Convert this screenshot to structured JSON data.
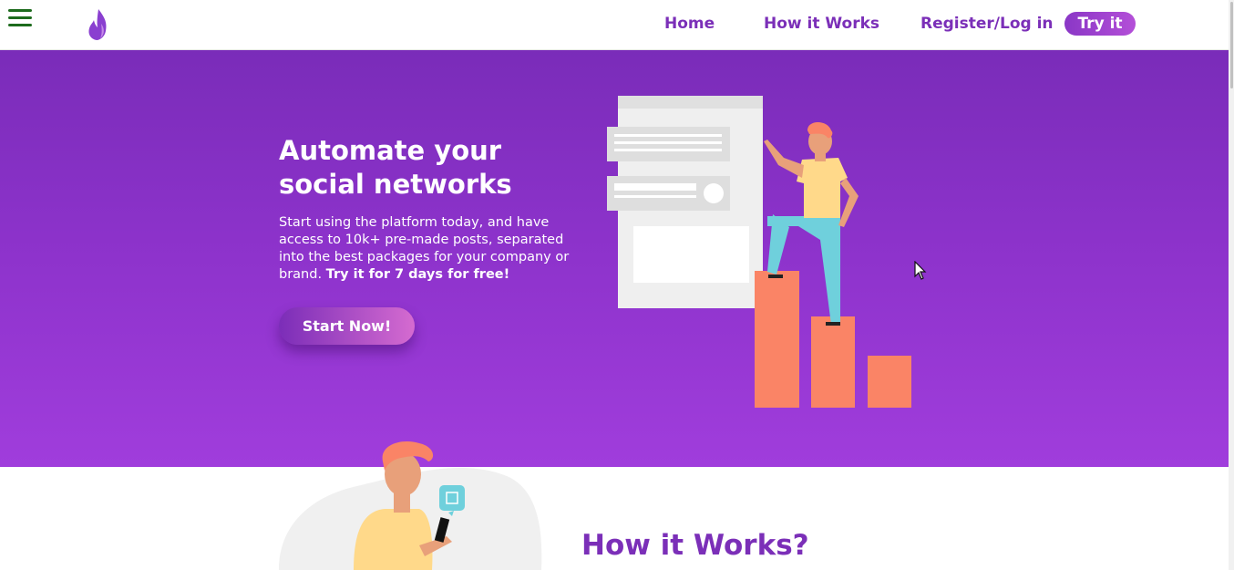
{
  "header": {
    "nav": {
      "home": "Home",
      "how_it_works": "How it Works",
      "register_login": "Register/Log in",
      "try_it": "Try it"
    }
  },
  "hero": {
    "title": "Automate your social networks",
    "description": "Start using the platform today, and have access to 10k+ pre-made posts, separated into the best packages for your company or brand.",
    "description_bold": "Try it for 7 days for free!",
    "cta_label": "Start Now!"
  },
  "how_section": {
    "title": "How it Works?"
  },
  "colors": {
    "brand_purple": "#7b2fb8",
    "hero_gradient_top": "#7a2cb9",
    "hero_gradient_bottom": "#a03ddc",
    "menu_green": "#1d6b1d",
    "bar_coral": "#fa8466"
  },
  "icons": {
    "menu": "hamburger-menu-icon",
    "logo": "flame-logo-icon",
    "like": "thumbs-up-icon"
  }
}
